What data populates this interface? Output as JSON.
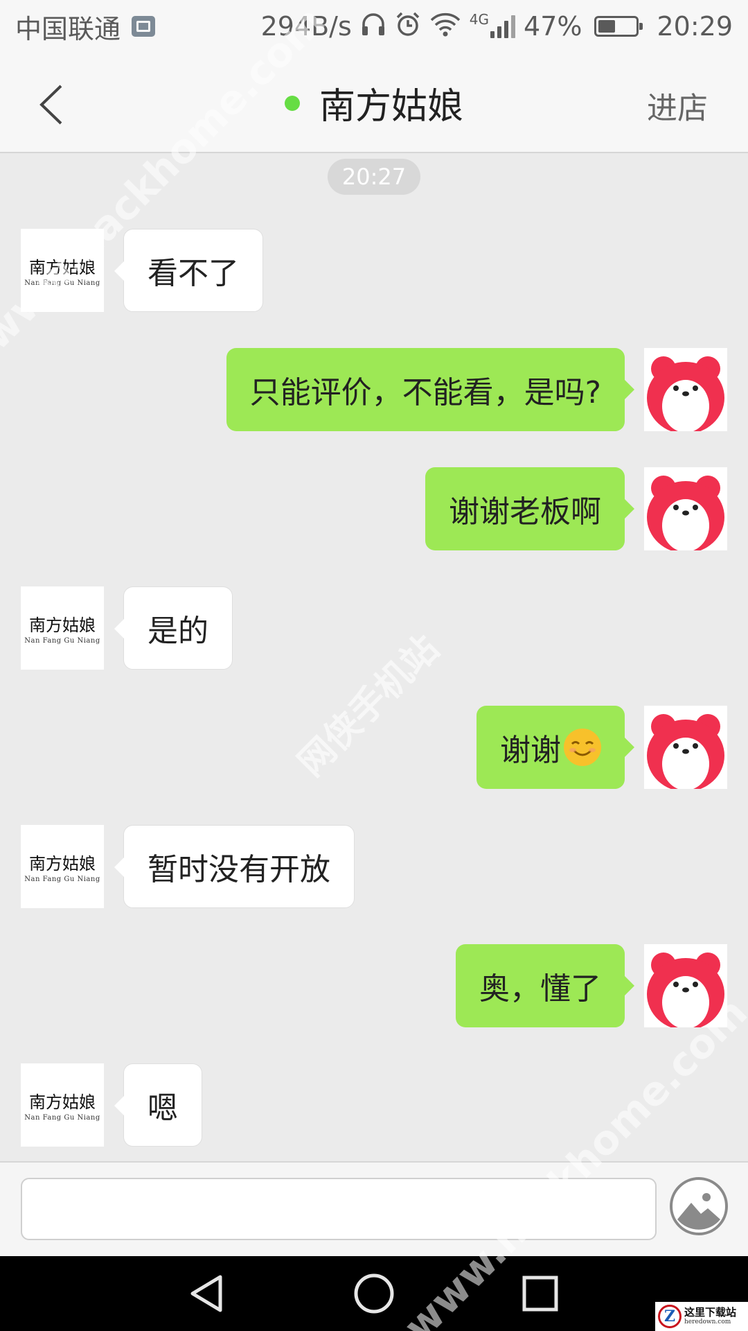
{
  "status_bar": {
    "carrier": "中国联通",
    "net_speed": "294B/s",
    "network_type": "4G",
    "battery": "47%",
    "battery_level": 0.47,
    "time": "20:29"
  },
  "header": {
    "title": "南方姑娘",
    "enter_shop_label": "进店",
    "online_color": "#66dd44"
  },
  "chat": {
    "timestamp": "20:27",
    "shop_avatar": {
      "cn": "南方姑娘",
      "en": "Nan Fang Gu Niang"
    },
    "messages": [
      {
        "from": "shop",
        "text": "看不了"
      },
      {
        "from": "me",
        "text": "只能评价，不能看，是吗?"
      },
      {
        "from": "me",
        "text": "谢谢老板啊"
      },
      {
        "from": "shop",
        "text": "是的"
      },
      {
        "from": "me",
        "text": "谢谢",
        "emoji": "smile-emoji"
      },
      {
        "from": "shop",
        "text": "暂时没有开放"
      },
      {
        "from": "me",
        "text": "奥，懂了"
      },
      {
        "from": "shop",
        "text": "嗯"
      }
    ]
  },
  "input": {
    "value": "",
    "placeholder": ""
  },
  "colors": {
    "outgoing_bubble": "#9de855",
    "incoming_bubble": "#ffffff",
    "background": "#ebebeb"
  },
  "watermarks": {
    "site_top": "www.hackhome.com",
    "site_bottom": "www.hackhome.com",
    "center": "网侠手机站",
    "corner_logo_title": "这里下载站",
    "corner_logo_url": "heredown.com"
  }
}
